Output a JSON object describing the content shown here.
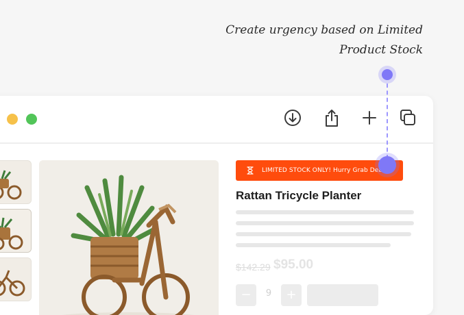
{
  "annotation": {
    "line1": "Create urgency based on Limited",
    "line2": "Product Stock"
  },
  "toolbar": {
    "icons": [
      "download-icon",
      "share-icon",
      "plus-icon",
      "copy-icon"
    ]
  },
  "product": {
    "stock_banner": "LIMITED STOCK ONLY! Hurry Grab Deal",
    "title": "Rattan Tricycle Planter",
    "price_old": "$142.29",
    "price_new": "$95.00",
    "quantity": "9",
    "quantity_minus": "−",
    "quantity_plus": "+"
  },
  "colors": {
    "banner": "#ff4c0d",
    "accent_pin": "#7f78f7",
    "traffic_yellow": "#f6c14a",
    "traffic_green": "#52c559"
  }
}
